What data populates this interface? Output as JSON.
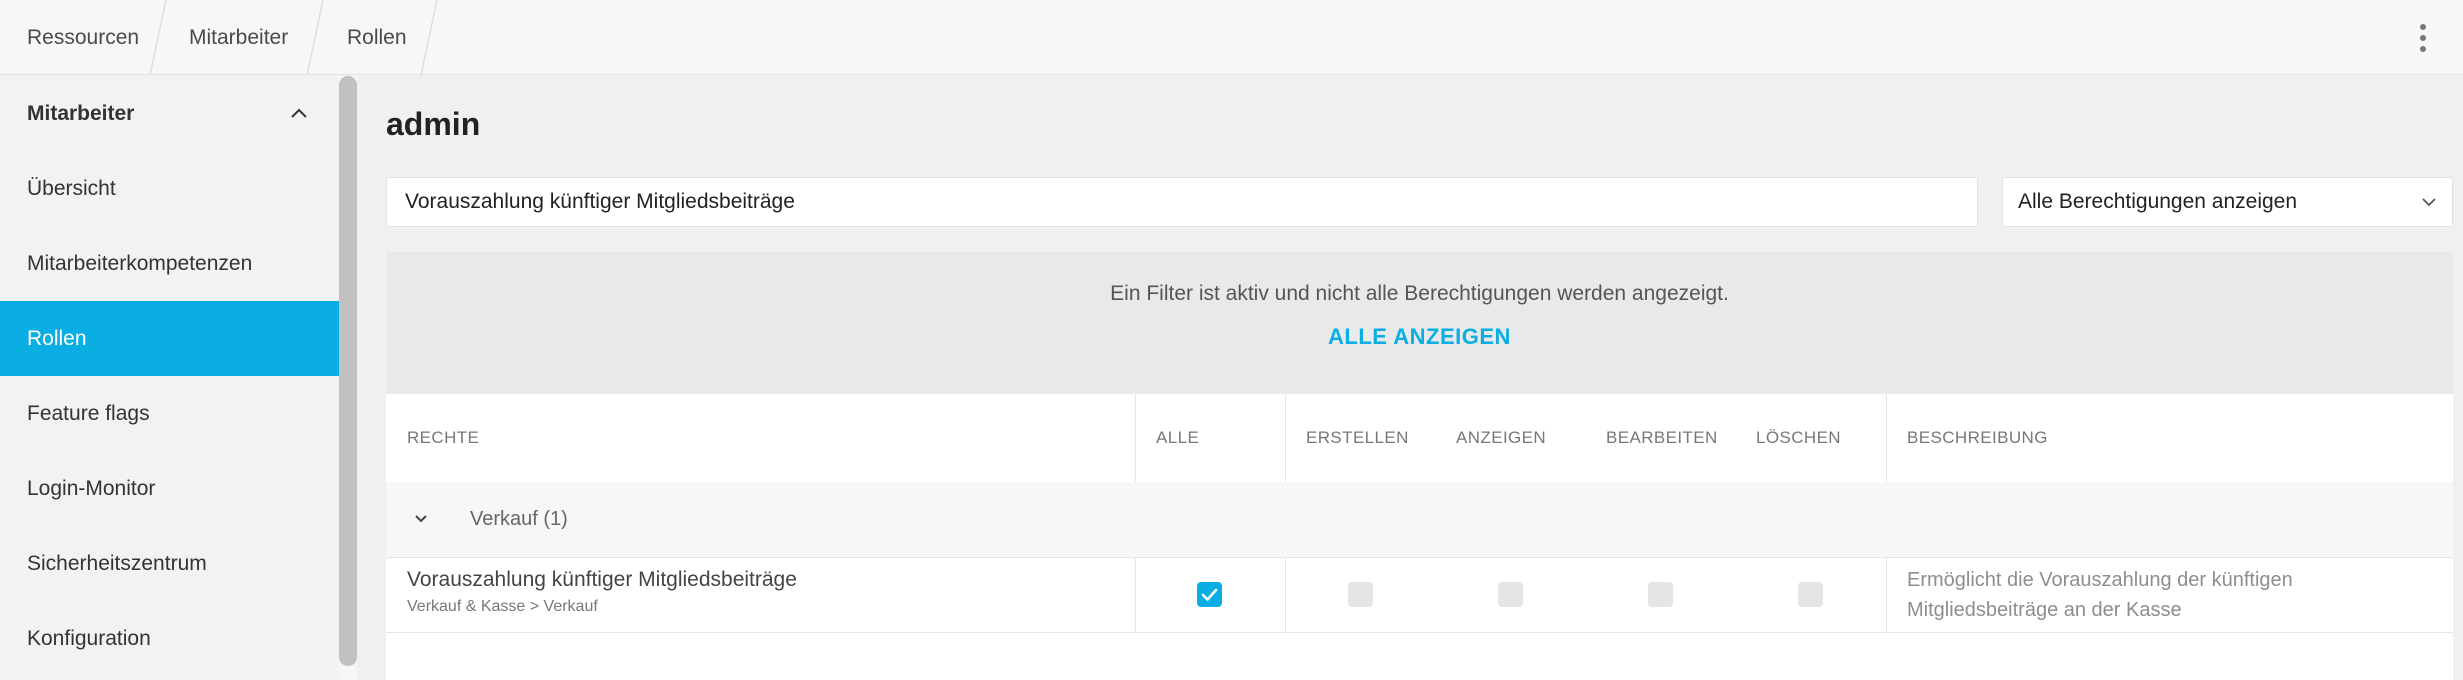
{
  "breadcrumb": [
    "Ressourcen",
    "Mitarbeiter",
    "Rollen"
  ],
  "sidebar": {
    "header": "Mitarbeiter",
    "items": [
      {
        "label": "Übersicht"
      },
      {
        "label": "Mitarbeiterkompetenzen"
      },
      {
        "label": "Rollen",
        "active": true
      },
      {
        "label": "Feature flags"
      },
      {
        "label": "Login-Monitor"
      },
      {
        "label": "Sicherheitszentrum"
      },
      {
        "label": "Konfiguration"
      }
    ]
  },
  "main": {
    "title": "admin",
    "search_value": "Vorauszahlung künftiger Mitgliedsbeiträge",
    "filter_select": "Alle Berechtigungen anzeigen",
    "filter_message": "Ein Filter ist aktiv und nicht alle Berechtigungen werden angezeigt.",
    "show_all_link": "ALLE ANZEIGEN"
  },
  "table": {
    "columns": {
      "rights": "RECHTE",
      "all": "ALLE",
      "create": "ERSTELLEN",
      "view": "ANZEIGEN",
      "edit": "BEARBEITEN",
      "delete": "LÖSCHEN",
      "description": "BESCHREIBUNG"
    },
    "group": {
      "label": "Verkauf (1)"
    },
    "rows": [
      {
        "title": "Vorauszahlung künftiger Mitgliedsbeiträge",
        "path": "Verkauf & Kasse > Verkauf",
        "all": true,
        "create": false,
        "view": false,
        "edit": false,
        "delete": false,
        "description": "Ermöglicht die Vorauszahlung der künftigen Mitgliedsbeiträge an der Kasse"
      }
    ]
  },
  "colors": {
    "accent": "#0aaee3"
  }
}
